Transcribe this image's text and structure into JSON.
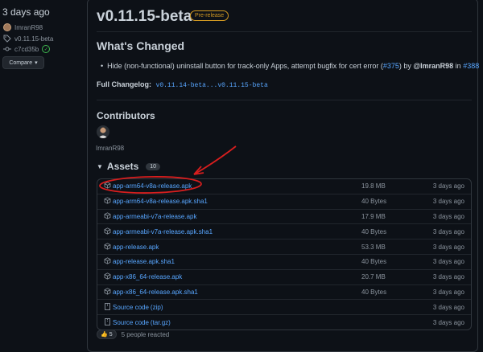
{
  "sidebar": {
    "time_ago": "3 days ago",
    "author": "ImranR98",
    "tag": "v0.11.15-beta",
    "commit": "c7cd35b",
    "compare_label": "Compare"
  },
  "release": {
    "title": "v0.11.15-beta",
    "badge": "Pre-release",
    "whats_changed": "What's Changed",
    "bullet_text": "Hide (non-functional) uninstall button for track-only Apps, attempt bugfix for cert error (",
    "bullet_issue": "#375",
    "bullet_by": ") by ",
    "bullet_author": "@ImranR98",
    "bullet_in": " in ",
    "bullet_pr": "#388",
    "changelog_label": "Full Changelog:",
    "changelog_link": "v0.11.14-beta...v0.11.15-beta"
  },
  "contributors": {
    "heading": "Contributors",
    "name": "ImranR98"
  },
  "assets": {
    "heading": "Assets",
    "count": "10",
    "items": [
      {
        "name": "app-arm64-v8a-release.apk",
        "size": "19.8 MB",
        "date": "3 days ago",
        "icon": "package-icon"
      },
      {
        "name": "app-arm64-v8a-release.apk.sha1",
        "size": "40 Bytes",
        "date": "3 days ago",
        "icon": "package-icon"
      },
      {
        "name": "app-armeabi-v7a-release.apk",
        "size": "17.9 MB",
        "date": "3 days ago",
        "icon": "package-icon"
      },
      {
        "name": "app-armeabi-v7a-release.apk.sha1",
        "size": "40 Bytes",
        "date": "3 days ago",
        "icon": "package-icon"
      },
      {
        "name": "app-release.apk",
        "size": "53.3 MB",
        "date": "3 days ago",
        "icon": "package-icon"
      },
      {
        "name": "app-release.apk.sha1",
        "size": "40 Bytes",
        "date": "3 days ago",
        "icon": "package-icon"
      },
      {
        "name": "app-x86_64-release.apk",
        "size": "20.7 MB",
        "date": "3 days ago",
        "icon": "package-icon"
      },
      {
        "name": "app-x86_64-release.apk.sha1",
        "size": "40 Bytes",
        "date": "3 days ago",
        "icon": "package-icon"
      },
      {
        "name": "Source code",
        "suffix": "(zip)",
        "size": "",
        "date": "3 days ago",
        "icon": "file-zip-icon"
      },
      {
        "name": "Source code",
        "suffix": "(tar.gz)",
        "size": "",
        "date": "3 days ago",
        "icon": "file-zip-icon"
      }
    ]
  },
  "reactions": {
    "emoji": "👍",
    "count": "5",
    "text": "5 people reacted"
  },
  "colors": {
    "link": "#58a6ff",
    "annotation": "#d81e1e",
    "prerelease": "#d29922"
  }
}
